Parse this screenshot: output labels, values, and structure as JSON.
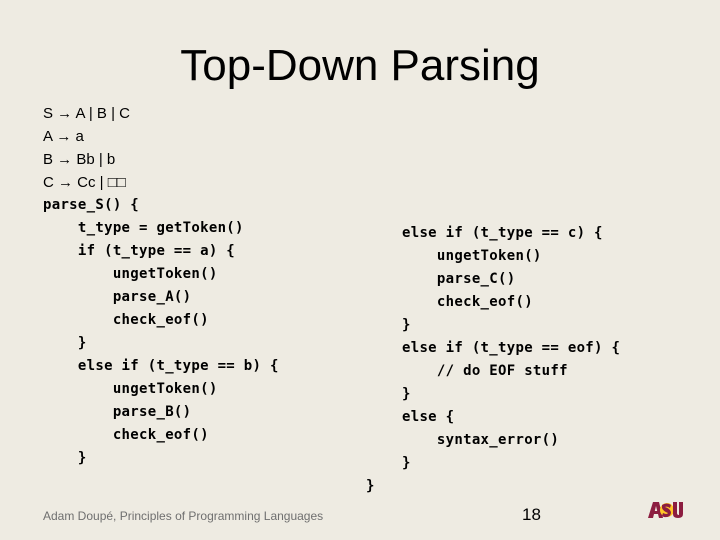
{
  "slide": {
    "title": "Top-Down Parsing",
    "grammar": [
      "S → A | B | C",
      "A → a",
      "B → Bb | b",
      "C → Cc | □□"
    ],
    "code_left": [
      "parse_S() {",
      "    t_type = getToken()",
      "    if (t_type == a) {",
      "        ungetToken()",
      "        parse_A()",
      "        check_eof()",
      "    }",
      "    else if (t_type == b) {",
      "        ungetToken()",
      "        parse_B()",
      "        check_eof()",
      "    }"
    ],
    "code_right": [
      "else if (t_type == c) {",
      "    ungetToken()",
      "    parse_C()",
      "    check_eof()",
      "}",
      "else if (t_type == eof) {",
      "    // do EOF stuff",
      "}",
      "else {",
      "    syntax_error()",
      "}"
    ],
    "closing_brace": "}",
    "footer": "Adam Doupé, Principles of Programming Languages",
    "page_number": "18",
    "logo": {
      "text": "ASU",
      "colors": {
        "maroon": "#8c1d40",
        "gold": "#ffc627"
      }
    }
  }
}
